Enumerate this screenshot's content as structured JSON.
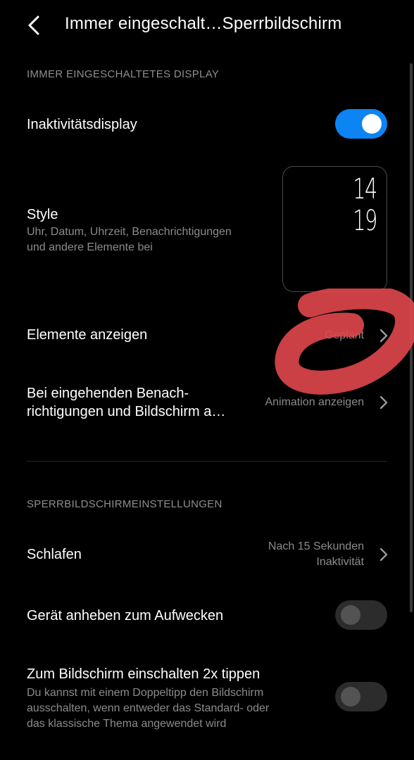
{
  "header": {
    "title": "Immer eingeschalt…Sperrbildschirm",
    "back_icon": "chevron-left-icon"
  },
  "aod_section": {
    "header": "IMMER EINGESCHALTETES DISPLAY",
    "inactivity_display": {
      "label": "Inaktivitätsdisplay",
      "enabled": true
    },
    "style": {
      "label": "Style",
      "subtitle_line1": "Uhr, Datum, Uhrzeit, Benachrichtigungen",
      "subtitle_line2": "und andere Elemente bei",
      "preview_hour": "14",
      "preview_minute": "19"
    },
    "show_elements": {
      "label": "Elemente anzeigen",
      "value": "Geplant"
    },
    "incoming_notifications": {
      "label_line1": "Bei eingehenden Benach-",
      "label_line2": "richtigungen und Bildschirm a…",
      "value": "Animation anzeigen"
    }
  },
  "lock_section": {
    "header": "SPERRBILDSCHIRMEINSTELLUNGEN",
    "sleep": {
      "label": "Schlafen",
      "value_line1": "Nach 15 Sekunden",
      "value_line2": "Inaktivität"
    },
    "raise_to_wake": {
      "label": "Gerät anheben zum Aufwecken",
      "enabled": false
    },
    "double_tap": {
      "label": "Zum Bildschirm einschalten 2x tippen",
      "subtitle_line1": "Du kannst mit einem Doppeltipp den Bildschirm",
      "subtitle_line2": "ausschalten, wenn entweder das Standard- oder",
      "subtitle_line3": "das klassische Thema angewendet wird",
      "enabled": false
    }
  },
  "colors": {
    "accent": "#0d84f4",
    "annotation": "#e0474c",
    "background": "#000000"
  }
}
